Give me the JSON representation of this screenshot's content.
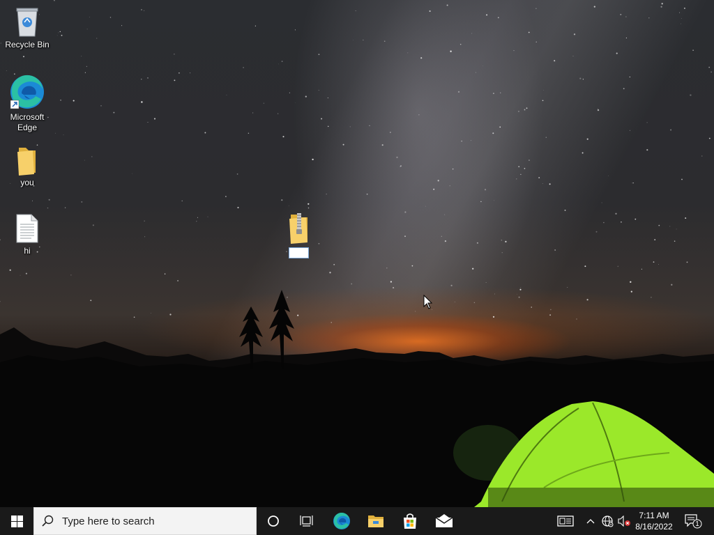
{
  "desktop": {
    "icons": [
      {
        "label": "Recycle Bin",
        "icon": "recycle-bin-icon"
      },
      {
        "label": "Microsoft Edge",
        "icon": "edge-icon"
      },
      {
        "label": "you",
        "icon": "folder-icon"
      },
      {
        "label": "hi",
        "icon": "text-document-icon"
      }
    ],
    "new_item": {
      "icon": "zip-folder-icon",
      "rename_value": ""
    }
  },
  "taskbar": {
    "start": {
      "icon": "windows-start-icon"
    },
    "search": {
      "placeholder": "Type here to search",
      "icon": "search-icon"
    },
    "cortana": {
      "icon": "cortana-circle-icon"
    },
    "task_view": {
      "icon": "task-view-icon"
    },
    "pinned": [
      {
        "name": "Microsoft Edge",
        "icon": "edge-icon"
      },
      {
        "name": "File Explorer",
        "icon": "file-explorer-icon"
      },
      {
        "name": "Microsoft Store",
        "icon": "store-icon"
      },
      {
        "name": "Mail",
        "icon": "mail-icon"
      }
    ],
    "tray": {
      "news_icon": "news-icon",
      "chevron_icon": "chevron-up-icon",
      "network_icon": "network-globe-icon",
      "volume_icon": "volume-muted-icon",
      "time": "7:11 AM",
      "date": "8/16/2022",
      "notifications_icon": "notification-icon",
      "notifications_count": "1"
    }
  },
  "colors": {
    "taskbar_bg": "#1a1a1a",
    "search_bg": "#f3f3f3",
    "folder_yellow": "#f5c84c",
    "tent_green": "#9be82a",
    "sunset_orange": "#ff7a1e"
  }
}
